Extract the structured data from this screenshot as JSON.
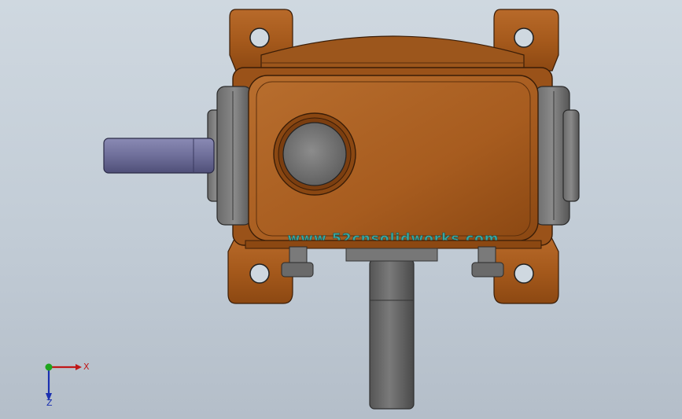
{
  "viewport": {
    "background_top": "#cfd8e0",
    "background_bottom": "#b4bec9"
  },
  "model": {
    "housing_color": "#a65a1c",
    "shaft_input_color": "#6f6f9a",
    "shaft_output_color": "#6b6b6b",
    "bearing_cap_color": "#5a5a5a",
    "casting_text": "www.52cnsolidworks.com",
    "casting_text_color": "#3aa7a0"
  },
  "triad": {
    "x_label": "X",
    "z_label": "Z",
    "x_color": "#c01818",
    "y_color": "#1ea51e",
    "z_color": "#1a2fb0"
  }
}
